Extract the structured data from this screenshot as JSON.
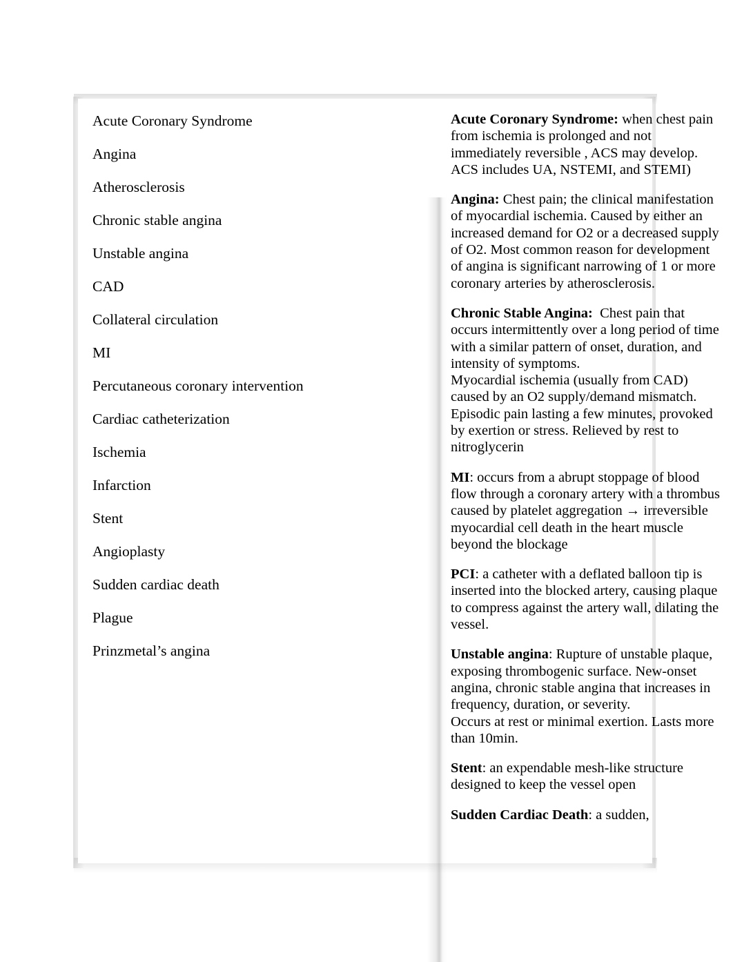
{
  "document": {
    "type": "two-column-study-guide-table",
    "terms_column": {
      "header": "",
      "items": [
        {
          "label": "Acute Coronary Syndrome"
        },
        {
          "label": "Angina"
        },
        {
          "label": "Atherosclerosis"
        },
        {
          "label": "Chronic stable angina"
        },
        {
          "label": "Unstable angina"
        },
        {
          "label": "CAD"
        },
        {
          "label": "Collateral circulation"
        },
        {
          "label": "MI"
        },
        {
          "label": "Percutaneous coronary intervention"
        },
        {
          "label": "Cardiac catheterization"
        },
        {
          "label": "Ischemia"
        },
        {
          "label": "Infarction"
        },
        {
          "label": "Stent"
        },
        {
          "label": "Angioplasty"
        },
        {
          "label": "Sudden cardiac death"
        },
        {
          "label": "Plague"
        },
        {
          "label": "Prinzmetal’s angina"
        }
      ]
    },
    "definitions_column": {
      "header": "",
      "entries": [
        {
          "term": "Acute Coronary Syndrome:",
          "definition": " when chest pain from ischemia is prolonged and not immediately reversible , ACS may develop. ACS includes UA, NSTEMI, and STEMI)"
        },
        {
          "term": "Angina:",
          "definition": " Chest pain; the clinical manifestation of myocardial ischemia. Caused by either an increased demand for O2 or a decreased supply of O2. Most common reason for development of angina is significant narrowing of 1 or more coronary arteries by atherosclerosis."
        },
        {
          "term": "Chronic Stable Angina:",
          "definition": "  Chest pain that occurs intermittently over a long period of time with a similar pattern of onset, duration, and intensity of symptoms.\nMyocardial ischemia (usually from CAD) caused by an O2 supply/demand mismatch. Episodic pain lasting a few minutes, provoked by exertion or stress. Relieved by rest to nitroglycerin"
        },
        {
          "term": "MI",
          "definition": ": occurs from a abrupt stoppage of blood flow through a coronary artery with a thrombus caused by platelet aggregation → irreversible myocardial cell death in the heart muscle beyond the blockage"
        },
        {
          "term": "PCI",
          "definition": ": a catheter with a deflated balloon tip is inserted into the blocked artery, causing plaque to compress against the artery wall, dilating the vessel."
        },
        {
          "term": "Unstable angina",
          "definition": ": Rupture of unstable plaque, exposing thrombogenic surface. New-onset angina, chronic stable angina that increases in frequency, duration, or severity.\nOccurs at rest or minimal exertion. Lasts more than 10min."
        },
        {
          "term": "Stent",
          "definition": ": an expendable mesh-like structure designed to keep the vessel open"
        },
        {
          "term": "Sudden Cardiac Death",
          "definition": ": a sudden,"
        }
      ]
    }
  }
}
